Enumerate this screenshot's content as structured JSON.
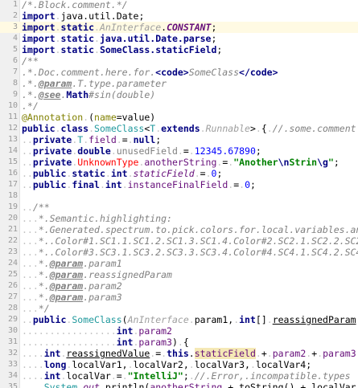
{
  "editor": {
    "current_line": 3,
    "lines": [
      {
        "n": "1",
        "tokens": [
          [
            "cmt",
            "/*.Block.comment.*/"
          ]
        ]
      },
      {
        "n": "2",
        "tokens": [
          [
            "kw",
            "import"
          ],
          [
            "ws",
            "."
          ],
          [
            "plain",
            "java.util."
          ],
          [
            "plain",
            "Date"
          ],
          [
            "plain",
            ";"
          ]
        ]
      },
      {
        "n": "3",
        "tokens": [
          [
            "kw",
            "import"
          ],
          [
            "ws",
            "."
          ],
          [
            "kw",
            "static"
          ],
          [
            "ws",
            "."
          ],
          [
            "intf",
            "AnInterface"
          ],
          [
            "plain",
            "."
          ],
          [
            "const",
            "CONSTANT"
          ],
          [
            "plain",
            ";"
          ]
        ]
      },
      {
        "n": "4",
        "tokens": [
          [
            "kw",
            "import"
          ],
          [
            "ws",
            "."
          ],
          [
            "kw",
            "static"
          ],
          [
            "ws",
            "."
          ],
          [
            "kw",
            "java.util.Date.parse"
          ],
          [
            "plain",
            ";"
          ]
        ]
      },
      {
        "n": "5",
        "tokens": [
          [
            "kw",
            "import"
          ],
          [
            "ws",
            "."
          ],
          [
            "kw",
            "static"
          ],
          [
            "ws",
            "."
          ],
          [
            "kw",
            "SomeClass.staticField"
          ],
          [
            "plain",
            ";"
          ]
        ]
      },
      {
        "n": "6",
        "tokens": [
          [
            "doc",
            "/**"
          ]
        ]
      },
      {
        "n": "7",
        "tokens": [
          [
            "doc",
            ".*.Doc.comment.here.for."
          ],
          [
            "htag",
            "<code>"
          ],
          [
            "doc",
            "SomeClass"
          ],
          [
            "htag",
            "</code>"
          ]
        ]
      },
      {
        "n": "8",
        "tokens": [
          [
            "doc",
            ".*."
          ],
          [
            "dtag",
            "@param"
          ],
          [
            "doc",
            ".T.type.parameter"
          ]
        ]
      },
      {
        "n": "9",
        "tokens": [
          [
            "doc",
            ".*."
          ],
          [
            "dtag",
            "@see"
          ],
          [
            "doc",
            "."
          ],
          [
            "htag",
            "Math"
          ],
          [
            "doc",
            "#sin(double)"
          ]
        ]
      },
      {
        "n": "10",
        "tokens": [
          [
            "doc",
            ".*/"
          ]
        ]
      },
      {
        "n": "11",
        "tokens": [
          [
            "ann",
            "@Annotation"
          ],
          [
            "ws",
            "."
          ],
          [
            "plain",
            "("
          ],
          [
            "ann",
            "name"
          ],
          [
            "plain",
            "=value)"
          ]
        ]
      },
      {
        "n": "12",
        "tokens": [
          [
            "kw",
            "public"
          ],
          [
            "ws",
            "."
          ],
          [
            "kw",
            "class"
          ],
          [
            "ws",
            "."
          ],
          [
            "cls",
            "SomeClass"
          ],
          [
            "plain",
            "<"
          ],
          [
            "tp",
            "T"
          ],
          [
            "ws",
            "."
          ],
          [
            "kw",
            "extends"
          ],
          [
            "ws",
            "."
          ],
          [
            "intf",
            "Runnable"
          ],
          [
            "plain",
            ">"
          ],
          [
            "ws",
            "."
          ],
          [
            "plain",
            "{"
          ],
          [
            "ws",
            "."
          ],
          [
            "cmt",
            "//.some.comment"
          ]
        ]
      },
      {
        "n": "13",
        "tokens": [
          [
            "ws",
            ".."
          ],
          [
            "kw",
            "private"
          ],
          [
            "ws",
            "."
          ],
          [
            "tp",
            "T"
          ],
          [
            "ws",
            "."
          ],
          [
            "field",
            "field"
          ],
          [
            "ws",
            "."
          ],
          [
            "plain",
            "="
          ],
          [
            "ws",
            "."
          ],
          [
            "kw",
            "null"
          ],
          [
            "plain",
            ";"
          ]
        ]
      },
      {
        "n": "14",
        "tokens": [
          [
            "ws",
            ".."
          ],
          [
            "kw",
            "private"
          ],
          [
            "ws",
            "."
          ],
          [
            "kw",
            "double"
          ],
          [
            "ws",
            "."
          ],
          [
            "unused",
            "unusedField"
          ],
          [
            "ws",
            "."
          ],
          [
            "plain",
            "="
          ],
          [
            "ws",
            "."
          ],
          [
            "num",
            "12345.67890"
          ],
          [
            "plain",
            ";"
          ]
        ]
      },
      {
        "n": "15",
        "tokens": [
          [
            "ws",
            ".."
          ],
          [
            "kw",
            "private"
          ],
          [
            "ws",
            "."
          ],
          [
            "err",
            "UnknownType"
          ],
          [
            "ws",
            "."
          ],
          [
            "field",
            "anotherString"
          ],
          [
            "ws",
            "."
          ],
          [
            "plain",
            "="
          ],
          [
            "ws",
            "."
          ],
          [
            "str",
            "\"Another"
          ],
          [
            "esc",
            "\\n"
          ],
          [
            "str",
            "Strin"
          ],
          [
            "esc",
            "\\g"
          ],
          [
            "str",
            "\""
          ],
          [
            "plain",
            ";"
          ]
        ]
      },
      {
        "n": "16",
        "tokens": [
          [
            "ws",
            ".."
          ],
          [
            "kw",
            "public"
          ],
          [
            "ws",
            "."
          ],
          [
            "kw",
            "static"
          ],
          [
            "ws",
            "."
          ],
          [
            "kw",
            "int"
          ],
          [
            "ws",
            "."
          ],
          [
            "staticf",
            "staticField"
          ],
          [
            "ws",
            "."
          ],
          [
            "plain",
            "="
          ],
          [
            "ws",
            "."
          ],
          [
            "num",
            "0"
          ],
          [
            "plain",
            ";"
          ]
        ]
      },
      {
        "n": "17",
        "tokens": [
          [
            "ws",
            ".."
          ],
          [
            "kw",
            "public"
          ],
          [
            "ws",
            "."
          ],
          [
            "kw",
            "final"
          ],
          [
            "ws",
            "."
          ],
          [
            "kw",
            "int"
          ],
          [
            "ws",
            "."
          ],
          [
            "field",
            "instanceFinalField"
          ],
          [
            "ws",
            "."
          ],
          [
            "plain",
            "="
          ],
          [
            "ws",
            "."
          ],
          [
            "num",
            "0"
          ],
          [
            "plain",
            ";"
          ]
        ]
      },
      {
        "n": "18",
        "tokens": []
      },
      {
        "n": "19",
        "tokens": [
          [
            "ws",
            ".."
          ],
          [
            "doc",
            "/**"
          ]
        ]
      },
      {
        "n": "20",
        "tokens": [
          [
            "ws",
            "..."
          ],
          [
            "doc",
            "*.Semantic.highlighting:"
          ]
        ]
      },
      {
        "n": "21",
        "tokens": [
          [
            "ws",
            "..."
          ],
          [
            "doc",
            "*.Generated.spectrum.to.pick.colors.for.local.variables.and"
          ]
        ]
      },
      {
        "n": "22",
        "tokens": [
          [
            "ws",
            "..."
          ],
          [
            "doc",
            "*..Color#1.SC1.1.SC1.2.SC1.3.SC1.4.Color#2.SC2.1.SC2.2.SC2"
          ]
        ]
      },
      {
        "n": "23",
        "tokens": [
          [
            "ws",
            "..."
          ],
          [
            "doc",
            "*..Color#3.SC3.1.SC3.2.SC3.3.SC3.4.Color#4.SC4.1.SC4.2.SC4"
          ]
        ]
      },
      {
        "n": "24",
        "tokens": [
          [
            "ws",
            "..."
          ],
          [
            "doc",
            "*."
          ],
          [
            "dtag",
            "@param"
          ],
          [
            "doc",
            ".param1"
          ]
        ]
      },
      {
        "n": "25",
        "tokens": [
          [
            "ws",
            "..."
          ],
          [
            "doc",
            "*."
          ],
          [
            "dtag",
            "@param"
          ],
          [
            "doc",
            ".reassignedParam"
          ]
        ]
      },
      {
        "n": "26",
        "tokens": [
          [
            "ws",
            "..."
          ],
          [
            "doc",
            "*."
          ],
          [
            "dtag",
            "@param"
          ],
          [
            "doc",
            ".param2"
          ]
        ]
      },
      {
        "n": "27",
        "tokens": [
          [
            "ws",
            "..."
          ],
          [
            "doc",
            "*."
          ],
          [
            "dtag",
            "@param"
          ],
          [
            "doc",
            ".param3"
          ]
        ]
      },
      {
        "n": "28",
        "tokens": [
          [
            "ws",
            "..."
          ],
          [
            "doc",
            "*/"
          ]
        ]
      },
      {
        "n": "29",
        "tokens": [
          [
            "ws",
            ".."
          ],
          [
            "kw",
            "public"
          ],
          [
            "ws",
            "."
          ],
          [
            "cls",
            "SomeClass"
          ],
          [
            "plain",
            "("
          ],
          [
            "intf",
            "AnInterface"
          ],
          [
            "ws",
            "."
          ],
          [
            "param",
            "param1"
          ],
          [
            "plain",
            ","
          ],
          [
            "ws",
            "."
          ],
          [
            "kw",
            "int"
          ],
          [
            "plain",
            "[]"
          ],
          [
            "ws",
            "."
          ],
          [
            "reassigned",
            "reassignedParam"
          ]
        ]
      },
      {
        "n": "30",
        "tokens": [
          [
            "ws",
            "................."
          ],
          [
            "kw",
            "int"
          ],
          [
            "ws",
            "."
          ],
          [
            "field",
            "param2"
          ]
        ]
      },
      {
        "n": "31",
        "tokens": [
          [
            "ws",
            "................."
          ],
          [
            "kw",
            "int"
          ],
          [
            "ws",
            "."
          ],
          [
            "field",
            "param3"
          ],
          [
            "plain",
            ")"
          ],
          [
            "ws",
            "."
          ],
          [
            "plain",
            "{"
          ]
        ]
      },
      {
        "n": "32",
        "tokens": [
          [
            "ws",
            "...."
          ],
          [
            "kw",
            "int"
          ],
          [
            "ws",
            "."
          ],
          [
            "reassigned",
            "reassignedValue"
          ],
          [
            "ws",
            "."
          ],
          [
            "plain",
            "="
          ],
          [
            "ws",
            "."
          ],
          [
            "kw",
            "this"
          ],
          [
            "plain",
            "."
          ],
          [
            "statichl",
            "staticField"
          ],
          [
            "ws",
            "."
          ],
          [
            "plain",
            "+"
          ],
          [
            "ws",
            "."
          ],
          [
            "field",
            "param2"
          ],
          [
            "ws",
            "."
          ],
          [
            "plain",
            "+"
          ],
          [
            "ws",
            "."
          ],
          [
            "field",
            "param3"
          ]
        ]
      },
      {
        "n": "33",
        "tokens": [
          [
            "ws",
            "...."
          ],
          [
            "kw",
            "long"
          ],
          [
            "ws",
            "."
          ],
          [
            "plain",
            "localVar1"
          ],
          [
            "plain",
            ","
          ],
          [
            "ws",
            "."
          ],
          [
            "plain",
            "localVar2"
          ],
          [
            "plain",
            ","
          ],
          [
            "ws",
            "."
          ],
          [
            "plain",
            "localVar3"
          ],
          [
            "plain",
            ","
          ],
          [
            "ws",
            "."
          ],
          [
            "plain",
            "localVar4"
          ],
          [
            "plain",
            ";"
          ]
        ]
      },
      {
        "n": "34",
        "tokens": [
          [
            "ws",
            "...."
          ],
          [
            "kw",
            "int"
          ],
          [
            "ws",
            "."
          ],
          [
            "plain",
            "localVar"
          ],
          [
            "ws",
            "."
          ],
          [
            "plain",
            "="
          ],
          [
            "ws",
            "."
          ],
          [
            "str",
            "\"IntelliJ\""
          ],
          [
            "plain",
            ";"
          ],
          [
            "ws",
            "."
          ],
          [
            "cmt",
            "//.Error,.incompatible.types"
          ]
        ]
      },
      {
        "n": "35",
        "tokens": [
          [
            "ws",
            "...."
          ],
          [
            "cls",
            "System"
          ],
          [
            "plain",
            "."
          ],
          [
            "staticf",
            "out"
          ],
          [
            "plain",
            "."
          ],
          [
            "plain",
            "println"
          ],
          [
            "plain",
            "("
          ],
          [
            "field",
            "anotherString"
          ],
          [
            "ws",
            "."
          ],
          [
            "plain",
            "+"
          ],
          [
            "ws",
            "."
          ],
          [
            "plain",
            "toString"
          ],
          [
            "plain",
            "()"
          ],
          [
            "ws",
            "."
          ],
          [
            "plain",
            "+"
          ],
          [
            "ws",
            "."
          ],
          [
            "plain",
            "localVar"
          ]
        ]
      }
    ]
  }
}
